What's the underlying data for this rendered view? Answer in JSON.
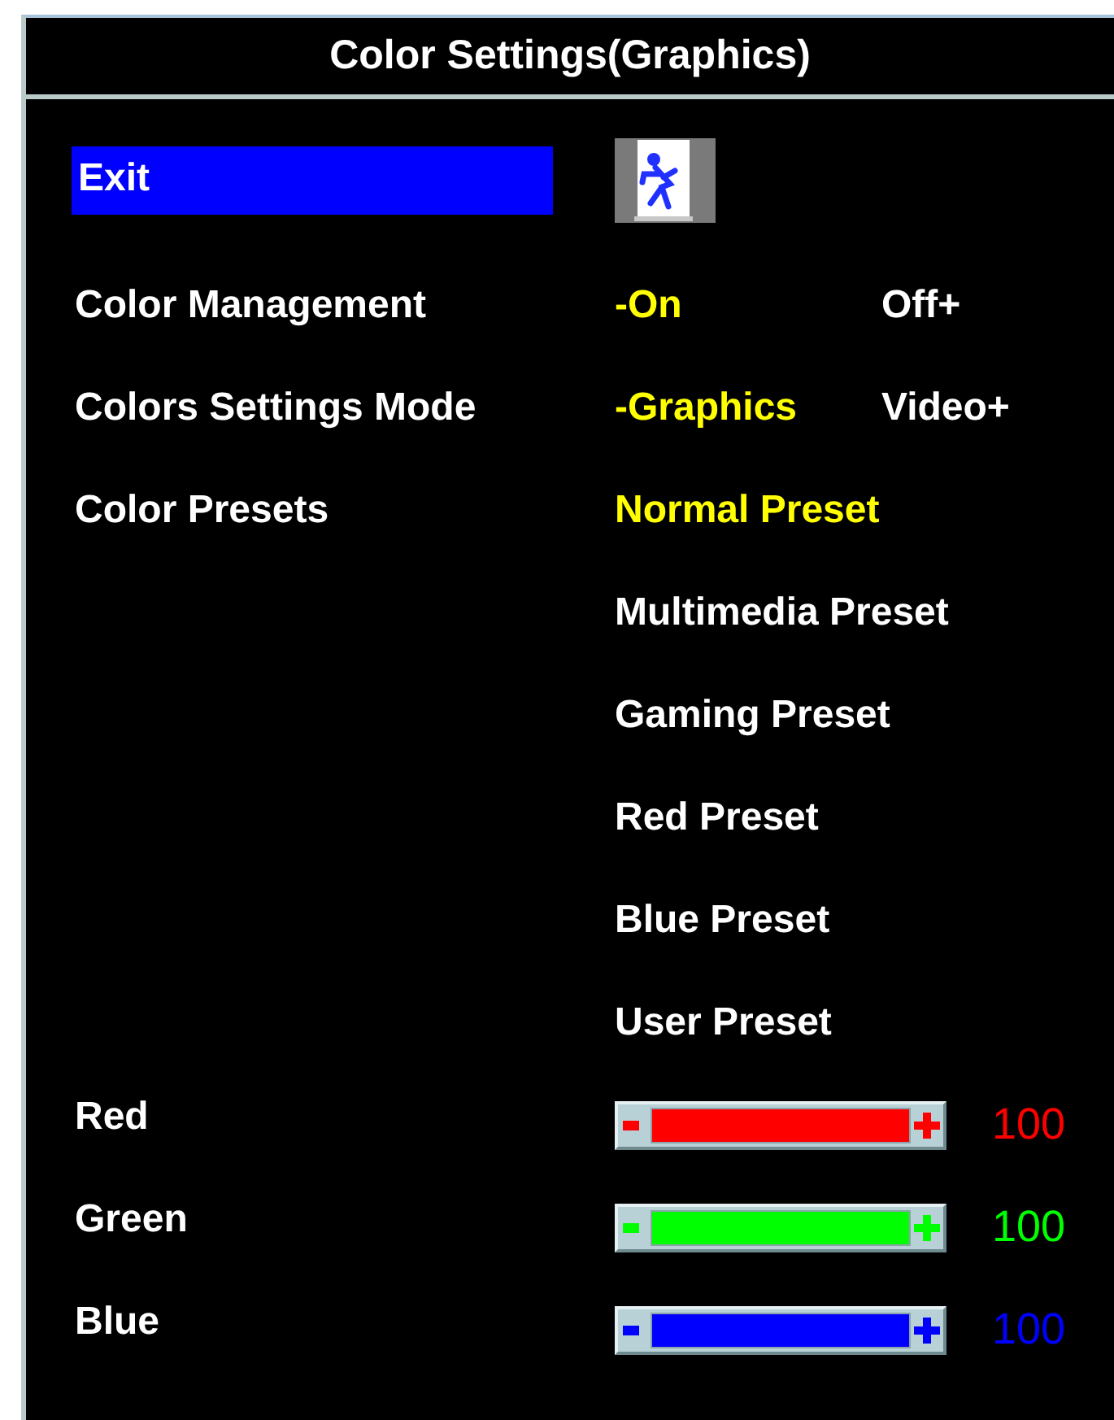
{
  "title": "Color Settings(Graphics)",
  "exit": {
    "label": "Exit",
    "selected": true
  },
  "rows": [
    {
      "label": "Color Management",
      "selected": false,
      "options": [
        {
          "text": "-On",
          "selected": true
        },
        {
          "text": "Off+",
          "selected": false
        }
      ]
    },
    {
      "label": "Colors Settings Mode",
      "selected": false,
      "options": [
        {
          "text": "-Graphics",
          "selected": true
        },
        {
          "text": "Video+",
          "selected": false
        }
      ]
    }
  ],
  "presets": {
    "label": "Color Presets",
    "selected": false,
    "items": [
      {
        "text": "Normal Preset",
        "selected": true
      },
      {
        "text": "Multimedia Preset",
        "selected": false
      },
      {
        "text": "Gaming Preset",
        "selected": false
      },
      {
        "text": "Red Preset",
        "selected": false
      },
      {
        "text": "Blue Preset",
        "selected": false
      },
      {
        "text": "User Preset",
        "selected": false
      }
    ]
  },
  "sliders": [
    {
      "label": "Red",
      "level": 1,
      "reading": "100",
      "color": "#ff0000"
    },
    {
      "label": "Green",
      "level": 1,
      "reading": "100",
      "color": "#00ff00"
    },
    {
      "label": "Blue",
      "level": 1,
      "reading": "100",
      "color": "#0000ff"
    }
  ]
}
